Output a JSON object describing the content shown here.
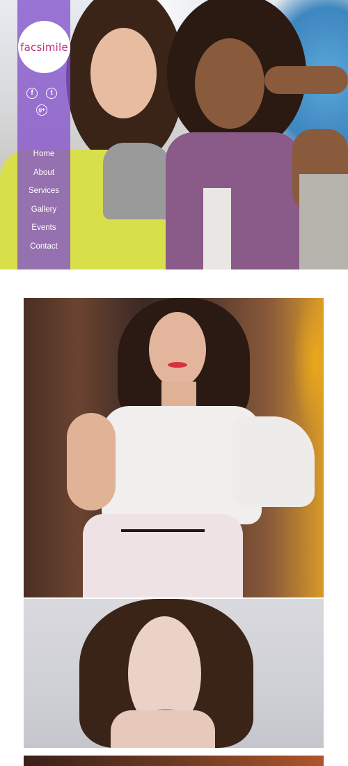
{
  "brand": {
    "logo_text": "facsimile"
  },
  "social": [
    {
      "icon": "facebook-icon",
      "glyph": "f"
    },
    {
      "icon": "twitter-icon",
      "glyph": "t"
    },
    {
      "icon": "google-plus-icon",
      "glyph": "g+"
    }
  ],
  "nav": {
    "items": [
      {
        "label": "Home"
      },
      {
        "label": "About"
      },
      {
        "label": "Services"
      },
      {
        "label": "Gallery"
      },
      {
        "label": "Events"
      },
      {
        "label": "Contact"
      }
    ]
  },
  "colors": {
    "sidebar": "#8452cc",
    "logo_text": "#c0307a",
    "nav_text": "#ffffff",
    "page_bg": "#ffffff"
  },
  "gallery": [
    {
      "name": "woman-white-lace-top-photo"
    },
    {
      "name": "brunette-portrait-photo"
    },
    {
      "name": "redhead-photo-partial"
    }
  ]
}
